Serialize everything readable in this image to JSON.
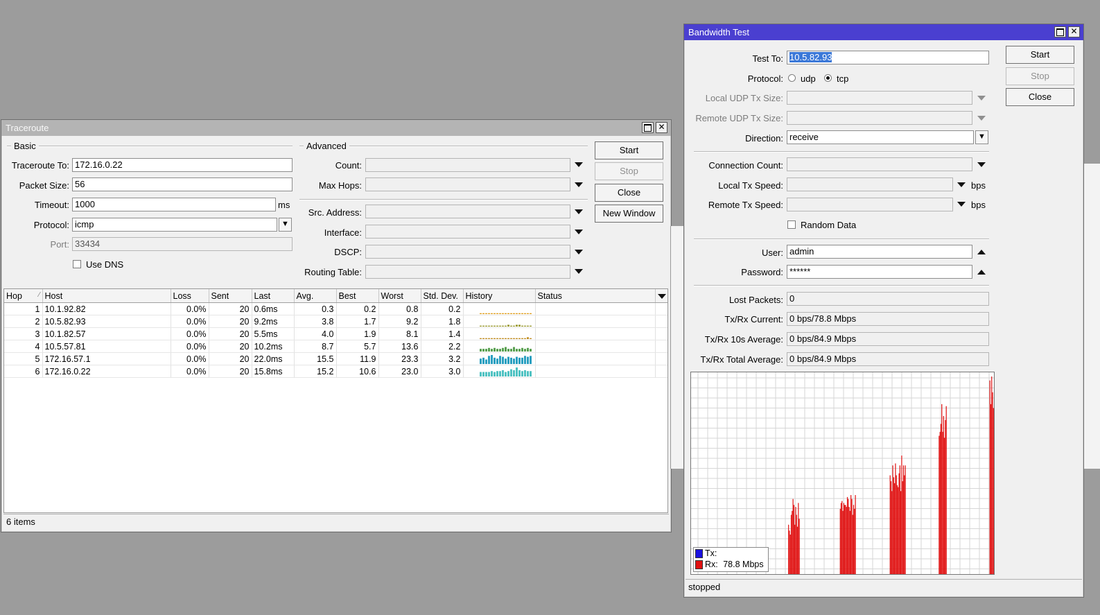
{
  "traceroute": {
    "title": "Traceroute",
    "basic_label": "Basic",
    "advanced_label": "Advanced",
    "fields": {
      "traceroute_to": {
        "label": "Traceroute To:",
        "value": "172.16.0.22"
      },
      "packet_size": {
        "label": "Packet Size:",
        "value": "56"
      },
      "timeout": {
        "label": "Timeout:",
        "value": "1000",
        "unit": "ms"
      },
      "protocol": {
        "label": "Protocol:",
        "value": "icmp"
      },
      "port": {
        "label": "Port:",
        "value": "33434"
      },
      "use_dns": {
        "label": "Use DNS",
        "checked": false
      },
      "count": {
        "label": "Count:",
        "value": ""
      },
      "max_hops": {
        "label": "Max Hops:",
        "value": ""
      },
      "src_address": {
        "label": "Src. Address:",
        "value": ""
      },
      "interface": {
        "label": "Interface:",
        "value": ""
      },
      "dscp": {
        "label": "DSCP:",
        "value": ""
      },
      "routing_table": {
        "label": "Routing Table:",
        "value": ""
      }
    },
    "buttons": {
      "start": "Start",
      "stop": "Stop",
      "close": "Close",
      "new_window": "New Window"
    },
    "columns": [
      "Hop",
      "Host",
      "Loss",
      "Sent",
      "Last",
      "Avg.",
      "Best",
      "Worst",
      "Std. Dev.",
      "History",
      "Status"
    ],
    "rows": [
      {
        "hop": "1",
        "host": "10.1.92.82",
        "loss": "0.0%",
        "sent": "20",
        "last": "0.6ms",
        "avg": "0.3",
        "best": "0.2",
        "worst": "0.8",
        "std": "0.2",
        "status": "",
        "history": [
          1,
          1,
          1,
          1,
          1,
          1,
          1,
          1,
          1,
          1,
          1,
          1,
          1,
          1,
          1,
          1,
          1,
          1,
          1,
          1
        ],
        "color": "#e0a020"
      },
      {
        "hop": "2",
        "host": "10.5.82.93",
        "loss": "0.0%",
        "sent": "20",
        "last": "9.2ms",
        "avg": "3.8",
        "best": "1.7",
        "worst": "9.2",
        "std": "1.8",
        "status": "",
        "history": [
          1,
          1,
          1,
          1,
          1,
          1,
          1,
          1,
          1,
          1,
          2,
          1,
          1,
          2,
          2,
          1,
          1,
          1,
          1,
          3
        ],
        "color": "#9a9a30"
      },
      {
        "hop": "3",
        "host": "10.1.82.57",
        "loss": "0.0%",
        "sent": "20",
        "last": "5.5ms",
        "avg": "4.0",
        "best": "1.9",
        "worst": "8.1",
        "std": "1.4",
        "status": "",
        "history": [
          1,
          1,
          1,
          1,
          1,
          1,
          1,
          1,
          1,
          1,
          1,
          1,
          1,
          1,
          1,
          1,
          1,
          2,
          1,
          3
        ],
        "color": "#c08d20"
      },
      {
        "hop": "4",
        "host": "10.5.57.81",
        "loss": "0.0%",
        "sent": "20",
        "last": "10.2ms",
        "avg": "8.7",
        "best": "5.7",
        "worst": "13.6",
        "std": "2.2",
        "status": "",
        "history": [
          3,
          3,
          3,
          4,
          3,
          4,
          3,
          3,
          4,
          5,
          3,
          3,
          5,
          3,
          3,
          4,
          3,
          4,
          3,
          4
        ],
        "color": "#58a050"
      },
      {
        "hop": "5",
        "host": "172.16.57.1",
        "loss": "0.0%",
        "sent": "20",
        "last": "22.0ms",
        "avg": "15.5",
        "best": "11.9",
        "worst": "23.3",
        "std": "3.2",
        "status": "",
        "history": [
          6,
          7,
          5,
          9,
          10,
          7,
          6,
          9,
          8,
          6,
          8,
          7,
          6,
          8,
          7,
          7,
          9,
          8,
          9,
          10
        ],
        "color": "#2a9fc0"
      },
      {
        "hop": "6",
        "host": "172.16.0.22",
        "loss": "0.0%",
        "sent": "20",
        "last": "15.8ms",
        "avg": "15.2",
        "best": "10.6",
        "worst": "23.0",
        "std": "3.0",
        "status": "",
        "history": [
          5,
          5,
          5,
          5,
          6,
          5,
          6,
          6,
          7,
          5,
          6,
          8,
          7,
          10,
          7,
          6,
          7,
          6,
          6,
          7
        ],
        "color": "#4fc2c2"
      }
    ],
    "status_bar": "6 items"
  },
  "bandwidth": {
    "title": "Bandwidth Test",
    "fields": {
      "test_to": {
        "label": "Test To:",
        "value": "10.5.82.93"
      },
      "protocol": {
        "label": "Protocol:",
        "options": [
          "udp",
          "tcp"
        ],
        "selected": "tcp"
      },
      "local_udp_tx_size": {
        "label": "Local UDP Tx Size:",
        "value": ""
      },
      "remote_udp_tx_size": {
        "label": "Remote UDP Tx Size:",
        "value": ""
      },
      "direction": {
        "label": "Direction:",
        "value": "receive"
      },
      "connection_count": {
        "label": "Connection Count:",
        "value": ""
      },
      "local_tx_speed": {
        "label": "Local Tx Speed:",
        "value": "",
        "unit": "bps"
      },
      "remote_tx_speed": {
        "label": "Remote Tx Speed:",
        "value": "",
        "unit": "bps"
      },
      "random_data": {
        "label": "Random Data",
        "checked": false
      },
      "user": {
        "label": "User:",
        "value": "admin"
      },
      "password": {
        "label": "Password:",
        "value": "******"
      },
      "lost_packets": {
        "label": "Lost Packets:",
        "value": "0"
      },
      "txrx_current": {
        "label": "Tx/Rx Current:",
        "value": "0 bps/78.8 Mbps"
      },
      "txrx_10s": {
        "label": "Tx/Rx 10s Average:",
        "value": "0 bps/84.9 Mbps"
      },
      "txrx_total": {
        "label": "Tx/Rx Total Average:",
        "value": "0 bps/84.9 Mbps"
      }
    },
    "buttons": {
      "start": "Start",
      "stop": "Stop",
      "close": "Close"
    },
    "legend": {
      "tx": "Tx:",
      "rx": "Rx:",
      "rx_value": "78.8 Mbps"
    },
    "colors": {
      "tx": "#1a10e0",
      "rx": "#e01010"
    },
    "status_bar": "stopped",
    "rx_bars": [
      0,
      0,
      0,
      0,
      0,
      0,
      0,
      0,
      0,
      0,
      0,
      0,
      0,
      0,
      0,
      0,
      0,
      0,
      0,
      0,
      0,
      0,
      0,
      0,
      0,
      0,
      0,
      0,
      0,
      0,
      0,
      0,
      0,
      0,
      0,
      0,
      0,
      0,
      0,
      0,
      0,
      0,
      0,
      0,
      0,
      0,
      0,
      0,
      0,
      0,
      0,
      0,
      0,
      0,
      0,
      0,
      0,
      0,
      0,
      0,
      0,
      0,
      0,
      0,
      0,
      0,
      0,
      0,
      0,
      0,
      0,
      0,
      0,
      0,
      0,
      0,
      0,
      0,
      0,
      0,
      0,
      0,
      0,
      0,
      0,
      0,
      0,
      0,
      0,
      0,
      0,
      0,
      0,
      0,
      0,
      0,
      0,
      0,
      0,
      0,
      0,
      0,
      0,
      0,
      0,
      0,
      0,
      0,
      0,
      25,
      22,
      20,
      30,
      32,
      38,
      35,
      25,
      34,
      30,
      24,
      36,
      28,
      0,
      0,
      0,
      0,
      0,
      0,
      0,
      0,
      0,
      0,
      0,
      0,
      0,
      0,
      0,
      0,
      0,
      0,
      0,
      0,
      0,
      0,
      0,
      0,
      0,
      0,
      0,
      0,
      0,
      0,
      0,
      0,
      0,
      0,
      0,
      0,
      0,
      0,
      0,
      0,
      0,
      0,
      0,
      0,
      0,
      33,
      36,
      37,
      32,
      36,
      35,
      35,
      34,
      39,
      38,
      34,
      32,
      40,
      38,
      30,
      35,
      33,
      40,
      0,
      0,
      0,
      0,
      0,
      0,
      0,
      0,
      0,
      0,
      0,
      0,
      0,
      0,
      0,
      0,
      0,
      0,
      0,
      0,
      0,
      0,
      0,
      0,
      0,
      0,
      0,
      0,
      0,
      0,
      0,
      0,
      0,
      0,
      0,
      0,
      0,
      0,
      50,
      47,
      42,
      55,
      49,
      46,
      56,
      50,
      45,
      44,
      51,
      55,
      42,
      60,
      47,
      55,
      50,
      55,
      0,
      0,
      0,
      0,
      0,
      0,
      0,
      0,
      0,
      0,
      0,
      0,
      0,
      0,
      0,
      0,
      0,
      0,
      0,
      0,
      0,
      0,
      0,
      0,
      0,
      0,
      0,
      0,
      0,
      0,
      0,
      0,
      0,
      0,
      0,
      0,
      0,
      70,
      72,
      76,
      86,
      72,
      80,
      69,
      78,
      85,
      0,
      0,
      0,
      0,
      0,
      0,
      0,
      0,
      0,
      0,
      0,
      0,
      0,
      0,
      0,
      0,
      0,
      0,
      0,
      0,
      0,
      0,
      0,
      0,
      0,
      0,
      0,
      0,
      0,
      0,
      0,
      0,
      0,
      0,
      0,
      0,
      0,
      0,
      0,
      0,
      0,
      0,
      0,
      0,
      0,
      0,
      0,
      0,
      98,
      86,
      100,
      92,
      84
    ]
  }
}
